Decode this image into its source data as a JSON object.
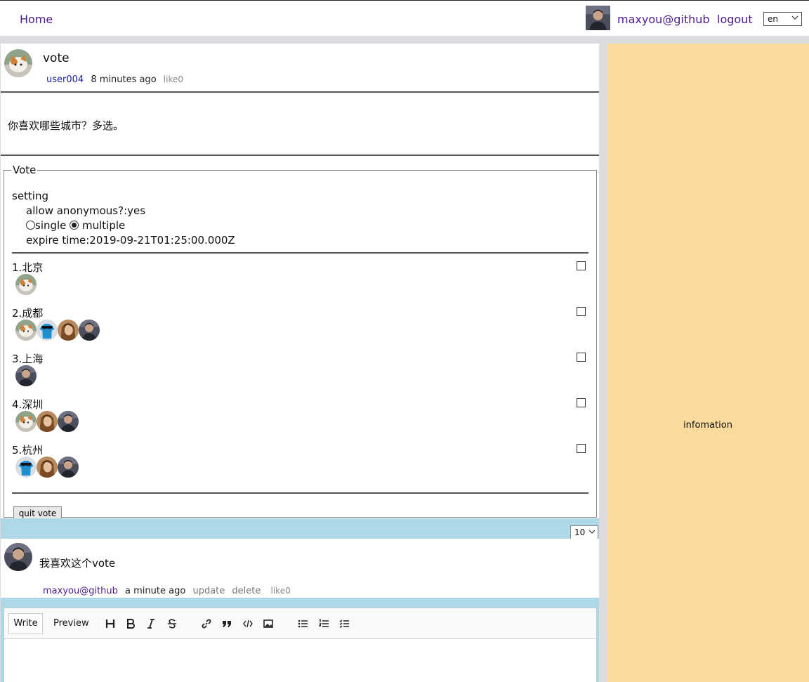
{
  "nav": {
    "home": "Home",
    "user": "maxyou@github",
    "logout": "logout",
    "language": "en"
  },
  "post": {
    "title": "vote",
    "author": "user004",
    "time": "8 minutes ago",
    "like": "like0",
    "body": "你喜欢哪些城市？多选。"
  },
  "vote": {
    "legend": "Vote",
    "setting_label": "setting",
    "anonymous": "allow anonymous?:yes",
    "mode_single": "single",
    "mode_multiple": "multiple",
    "selected_mode": "multiple",
    "expire": "expire time:2019-09-21T01:25:00.000Z",
    "options": [
      {
        "label": "1.北京",
        "voters": [
          "cat"
        ]
      },
      {
        "label": "2.成都",
        "voters": [
          "cat",
          "shirt",
          "woman",
          "man"
        ]
      },
      {
        "label": "3.上海",
        "voters": [
          "man"
        ]
      },
      {
        "label": "4.深圳",
        "voters": [
          "cat",
          "woman",
          "man"
        ]
      },
      {
        "label": "5.杭州",
        "voters": [
          "shirt",
          "woman",
          "man"
        ]
      }
    ],
    "quit_button": "quit vote"
  },
  "pagination": {
    "page_size": "10"
  },
  "comment": {
    "text": "我喜欢这个vote",
    "author": "maxyou@github",
    "time": "a minute ago",
    "update": "update",
    "delete": "delete",
    "like": "like0"
  },
  "editor": {
    "tab_write": "Write",
    "tab_preview": "Preview",
    "tools": [
      "header-icon",
      "bold-icon",
      "italic-icon",
      "strikethrough-icon",
      "link-icon",
      "quote-icon",
      "code-icon",
      "image-icon",
      "unordered-list-icon",
      "ordered-list-icon",
      "checklist-icon"
    ]
  },
  "sidebar": {
    "info": "infomation"
  }
}
